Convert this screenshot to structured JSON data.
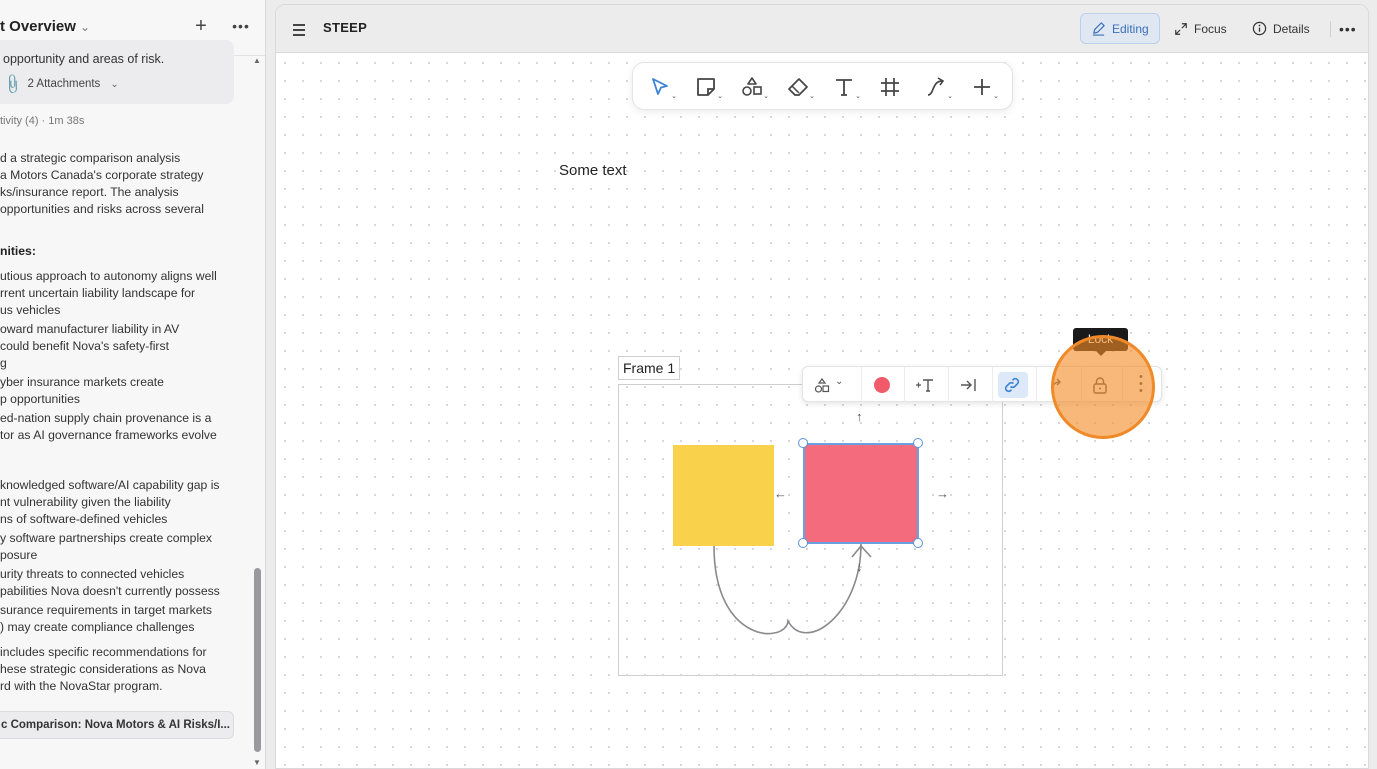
{
  "left_panel": {
    "title": "t Overview",
    "card_text": "opportunity and areas of risk.",
    "attachments_label": "2 Attachments",
    "activity_label": "tivity (4) · 1m 38s",
    "body_lines": [
      "d a strategic comparison analysis",
      "a Motors Canada's corporate strategy",
      "ks/insurance report. The analysis",
      " opportunities and risks across several",
      "",
      "nities:",
      "",
      "utious approach to autonomy aligns well",
      "rrent uncertain liability landscape for",
      "us vehicles",
      "oward manufacturer liability in AV",
      "could benefit Nova's safety-first",
      "g",
      "yber insurance markets create",
      "p opportunities",
      "ed-nation supply chain provenance is a",
      "tor as AI governance frameworks evolve",
      "",
      "knowledged software/AI capability gap is",
      "nt vulnerability given the liability",
      "ns of software-defined vehicles",
      "y software partnerships create complex",
      "posure",
      "urity threats to connected vehicles",
      "pabilities Nova doesn't currently possess",
      "surance requirements in target markets",
      ") may create compliance challenges",
      "includes specific recommendations for",
      "hese strategic considerations as Nova",
      "rd with the NovaStar program."
    ],
    "chip_label": "c Comparison: Nova Motors & AI Risks/I..."
  },
  "topbar": {
    "doc_title": "STEEP",
    "editing_label": "Editing",
    "focus_label": "Focus",
    "details_label": "Details"
  },
  "canvas": {
    "some_text": "Some text",
    "frame_label": "Frame 1",
    "tooltip": "Lock",
    "colors": {
      "yellow_shape": "#f9d14a",
      "pink_shape": "#f56b7e",
      "selection": "#5a93d8",
      "highlight": "#f08a28"
    }
  },
  "tools": [
    "select-tool",
    "sticky-note-tool",
    "shapes-tool",
    "eraser-tool",
    "text-tool",
    "frame-tool",
    "connector-tool",
    "add-tool"
  ],
  "context_toolbar": [
    "shape-type",
    "fill-color",
    "add-text",
    "navigate",
    "link",
    "redo",
    "lock",
    "more"
  ]
}
